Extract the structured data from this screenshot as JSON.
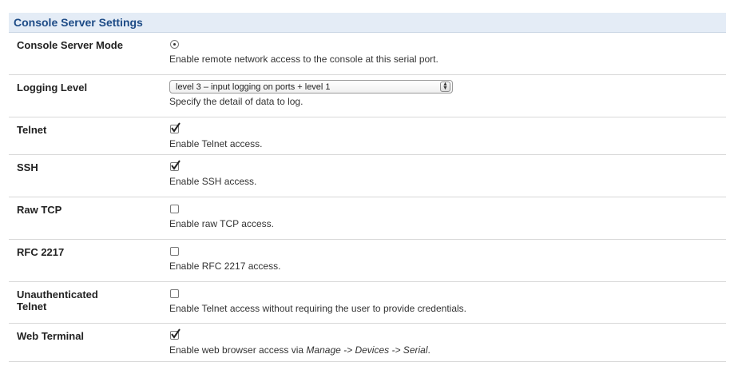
{
  "header": {
    "title": "Console Server Settings"
  },
  "rows": [
    {
      "label": "Console Server Mode",
      "control": "radio",
      "checked": true,
      "desc": "Enable remote network access to the console at this serial port."
    },
    {
      "label": "Logging Level",
      "control": "select",
      "selected": "level 3 – input logging on ports + level 1",
      "desc": "Specify the detail of data to log."
    },
    {
      "label": "Telnet",
      "control": "checkbox",
      "checked": true,
      "desc": "Enable Telnet access."
    },
    {
      "label": "SSH",
      "control": "checkbox",
      "checked": true,
      "desc": "Enable SSH access."
    },
    {
      "label": "Raw TCP",
      "control": "checkbox",
      "checked": false,
      "desc": "Enable raw TCP access."
    },
    {
      "label": "RFC 2217",
      "control": "checkbox",
      "checked": false,
      "desc": "Enable RFC 2217 access."
    },
    {
      "label_line1": "Unauthenticated",
      "label_line2": "Telnet",
      "control": "checkbox",
      "checked": false,
      "desc": "Enable Telnet access without requiring the user to provide credentials."
    },
    {
      "label": "Web Terminal",
      "control": "checkbox",
      "checked": true,
      "desc_prefix": "Enable web browser access via ",
      "desc_path": "Manage -> Devices -> Serial",
      "desc_suffix": "."
    }
  ]
}
